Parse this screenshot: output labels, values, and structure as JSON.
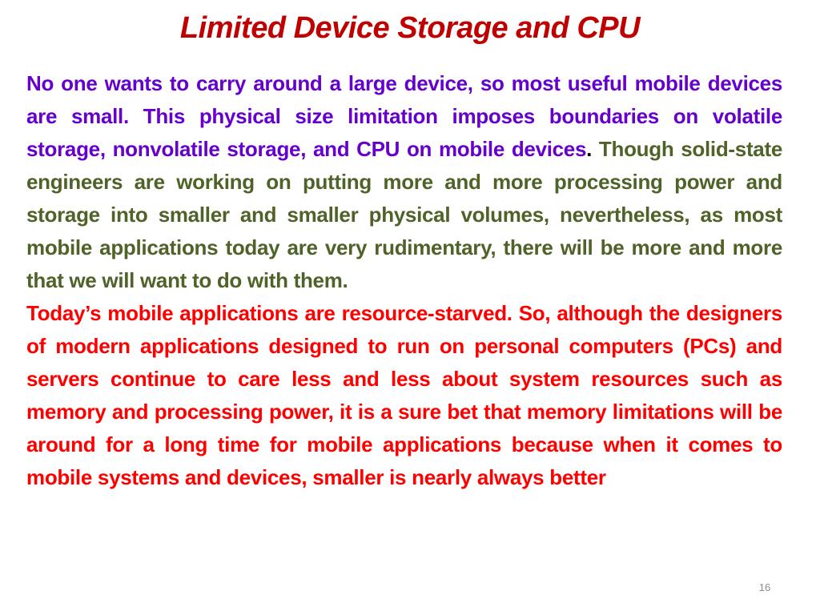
{
  "slide": {
    "title": "Limited Device Storage and CPU",
    "paragraph1": {
      "purple_text": "No one wants to carry around a large device, so most useful mobile devices are  small. This physical size limitation imposes boundaries on volatile storage, nonvolatile  storage, and CPU on mobile devices",
      "period": ".",
      "olive_text": " Though solid-state engineers are working on putting more and more processing power and storage into smaller and smaller physical volumes, nevertheless, as most mobile applications today are  very rudimentary, there will be more and more that we will want to do with them."
    },
    "paragraph2": {
      "red_text": "Today’s mobile applications are resource-starved. So, although the designers of  modern applications designed to run on personal computers (PCs) and servers  continue to care less and less about system resources such as memory and processing  power, it is a sure bet that memory limitations will be around for a long time for mobile applications because when it comes to mobile systems and devices,  smaller is nearly always better"
    },
    "page_number": "16",
    "colors": {
      "title": "#c00000",
      "purple": "#6600cc",
      "olive": "#4f6228",
      "red": "#ff0000"
    }
  }
}
